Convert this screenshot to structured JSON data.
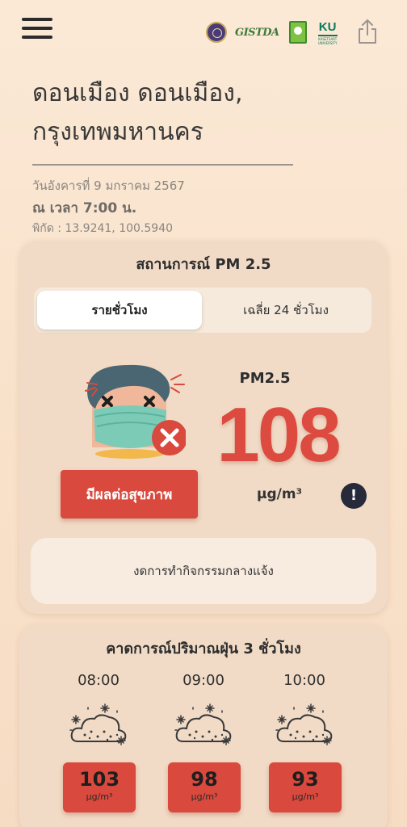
{
  "header": {
    "menu_icon": "hamburger-menu-icon",
    "logos": [
      "university-seal-logo",
      "gistda-logo",
      "nrct-logo",
      "ku-logo"
    ],
    "gistda_text": "GISTDA",
    "ku_text": "KU",
    "ku_sub": "KASETSART UNIVERSITY",
    "share_icon": "share-icon"
  },
  "location": {
    "line1": "ดอนเมือง ดอนเมือง,",
    "line2": "กรุงเทพมหานคร",
    "date": "วันอังคารที่ 9 มกราคม 2567",
    "time": "ณ เวลา 7:00 น.",
    "coordinates": "พิกัด : 13.9241, 100.5940"
  },
  "pm_card": {
    "title": "สถานการณ์ PM 2.5",
    "tabs": [
      {
        "label": "รายชั่วโมง",
        "selected": true
      },
      {
        "label": "เฉลี่ย 24 ชั่วโมง",
        "selected": false
      }
    ],
    "pm_label": "PM2.5",
    "value": "108",
    "unit": "µg/m³",
    "status": "มีผลต่อสุขภาพ",
    "advice": "งดการทำกิจกรรมกลางแจ้ง",
    "status_color": "#d9493d",
    "value_color": "#dd4a3f",
    "info_icon": "exclamation-info-icon",
    "mascot_icon": "sick-masked-face-icon"
  },
  "forecast": {
    "title": "คาดการณ์ปริมาณฝุ่น 3 ชั่วโมง",
    "items": [
      {
        "time": "08:00",
        "value": "103",
        "unit": "µg/m³",
        "icon": "dust-cloud-icon"
      },
      {
        "time": "09:00",
        "value": "98",
        "unit": "µg/m³",
        "icon": "dust-cloud-icon"
      },
      {
        "time": "10:00",
        "value": "93",
        "unit": "µg/m³",
        "icon": "dust-cloud-icon"
      }
    ]
  }
}
